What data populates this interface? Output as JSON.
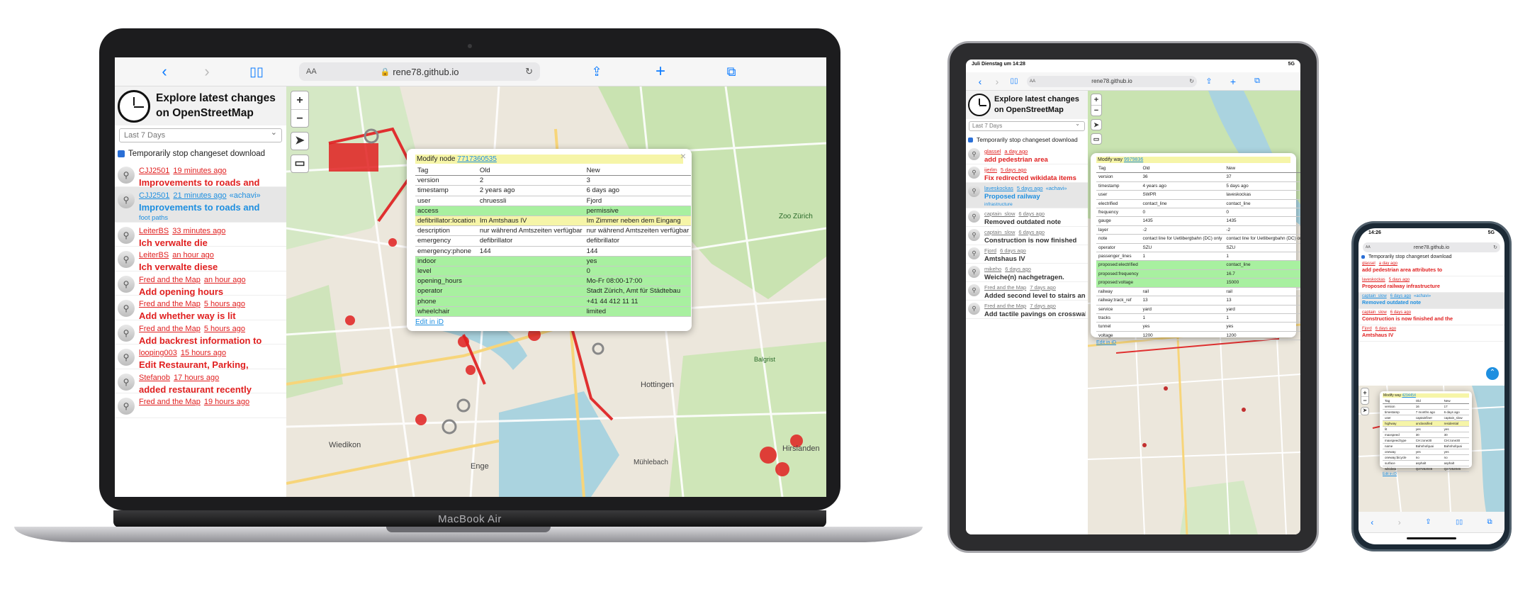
{
  "laptop": {
    "brand_label": "MacBook Air",
    "url": "rene78.github.io",
    "url_prefix": "AA",
    "app_title_line1": "Explore latest changes",
    "app_title_line2": "on OpenStreetMap",
    "period_select": "Last 7 Days",
    "stop_download_label": "Temporarily stop changeset download",
    "changesets": [
      {
        "user": "CJJ2501",
        "time": "19 minutes ago",
        "comment": "Improvements to roads and",
        "extra": "",
        "highlight": false
      },
      {
        "user": "CJJ2501",
        "time": "21 minutes ago",
        "comment": "Improvements to roads and",
        "extra": "«achavi»",
        "comment2": "foot paths",
        "highlight": true
      },
      {
        "user": "LeiterBS",
        "time": "33 minutes ago",
        "comment": "Ich verwalte die",
        "extra": "",
        "highlight": false
      },
      {
        "user": "LeiterBS",
        "time": "an hour ago",
        "comment": "Ich verwalte diese",
        "extra": "",
        "highlight": false
      },
      {
        "user": "Fred and the Map",
        "time": "an hour ago",
        "comment": "Add opening hours",
        "extra": "",
        "highlight": false
      },
      {
        "user": "Fred and the Map",
        "time": "5 hours ago",
        "comment": "Add whether way is lit",
        "extra": "",
        "highlight": false
      },
      {
        "user": "Fred and the Map",
        "time": "5 hours ago",
        "comment": "Add backrest information to",
        "extra": "",
        "highlight": false
      },
      {
        "user": "looping003",
        "time": "15 hours ago",
        "comment": "Edit Restaurant, Parking,",
        "extra": "",
        "highlight": false
      },
      {
        "user": "Stefanob",
        "time": "17 hours ago",
        "comment": "added restaurant recently",
        "extra": "",
        "highlight": false
      },
      {
        "user": "Fred and the Map",
        "time": "19 hours ago",
        "comment": "",
        "extra": "",
        "highlight": false
      }
    ],
    "popup": {
      "title_prefix": "Modify node",
      "node_id": "7717360535",
      "headers": [
        "Tag",
        "Old",
        "New"
      ],
      "rows": [
        {
          "tag": "version",
          "old": "2",
          "new": "3",
          "style": ""
        },
        {
          "tag": "timestamp",
          "old": "2 years ago",
          "new": "6 days ago",
          "style": ""
        },
        {
          "tag": "user",
          "old": "chruessli",
          "new": "Fjord",
          "style": ""
        },
        {
          "tag": "access",
          "old": "",
          "new": "permissive",
          "style": "g"
        },
        {
          "tag": "defibrillator:location",
          "old": "Im Amtshaus IV",
          "new": "Im Zimmer neben dem Eingang",
          "style": "y"
        },
        {
          "tag": "description",
          "old": "nur während Amtszeiten verfügbar",
          "new": "nur während Amtszeiten verfügbar",
          "style": ""
        },
        {
          "tag": "emergency",
          "old": "defibrillator",
          "new": "defibrillator",
          "style": ""
        },
        {
          "tag": "emergency:phone",
          "old": "144",
          "new": "144",
          "style": ""
        },
        {
          "tag": "indoor",
          "old": "",
          "new": "yes",
          "style": "g"
        },
        {
          "tag": "level",
          "old": "",
          "new": "0",
          "style": "g"
        },
        {
          "tag": "opening_hours",
          "old": "",
          "new": "Mo-Fr 08:00-17:00",
          "style": "g"
        },
        {
          "tag": "operator",
          "old": "",
          "new": "Stadt Zürich, Amt für Städtebau",
          "style": "g"
        },
        {
          "tag": "phone",
          "old": "",
          "new": "+41 44 412 11 11",
          "style": "g"
        },
        {
          "tag": "wheelchair",
          "old": "",
          "new": "limited",
          "style": "g"
        }
      ],
      "edit_link": "Edit in iD"
    },
    "map_labels": [
      "Zoo Zürich",
      "Wiedikon",
      "Hottingen",
      "Hirslanden",
      "Enge",
      "Mühlebach",
      "Balgrist"
    ]
  },
  "tablet": {
    "status_time": "Juli Dienstag um 14:28",
    "status_right": "5G",
    "url": "rene78.github.io",
    "url_prefix": "AA",
    "app_title_line1": "Explore latest changes",
    "app_title_line2": "on OpenStreetMap",
    "period_select": "Last 7 Days",
    "stop_download_label": "Temporarily stop changeset download",
    "changesets": [
      {
        "user": "glassel",
        "time": "a day ago",
        "comment": "add pedestrian area",
        "highlight": false
      },
      {
        "user": "ijerlm",
        "time": "5 days ago",
        "comment": "Fix redirected wikidata items",
        "highlight": false
      },
      {
        "user": "laveskockas",
        "time": "5 days ago",
        "extra": "«achavi»",
        "comment": "Proposed railway",
        "comment2": "infrastructure",
        "highlight": true
      },
      {
        "user": "captain_slow",
        "time": "6 days ago",
        "comment": "Removed outdated note",
        "highlight": false,
        "dark": true
      },
      {
        "user": "captain_slow",
        "time": "6 days ago",
        "comment": "Construction is now finished",
        "highlight": false,
        "dark": true
      },
      {
        "user": "Fjord",
        "time": "6 days ago",
        "comment": "Amtshaus IV",
        "highlight": false,
        "dark": true
      },
      {
        "user": "mikeho",
        "time": "6 days ago",
        "comment": "Weiche(n) nachgetragen.",
        "highlight": false,
        "dark": true
      },
      {
        "user": "Fred and the Map",
        "time": "7 days ago",
        "comment": "Added second level to stairs and",
        "highlight": false,
        "dark": true
      },
      {
        "user": "Fred and the Map",
        "time": "7 days ago",
        "comment": "Add tactile pavings on crosswalks",
        "highlight": false,
        "dark": true
      }
    ],
    "popup": {
      "title_prefix": "Modify way",
      "id": "9979836",
      "headers": [
        "Tag",
        "Old",
        "New"
      ],
      "rows": [
        {
          "tag": "version",
          "old": "36",
          "new": "37",
          "style": ""
        },
        {
          "tag": "timestamp",
          "old": "4 years ago",
          "new": "5 days ago",
          "style": ""
        },
        {
          "tag": "user",
          "old": "SWPR",
          "new": "laveskockas",
          "style": ""
        },
        {
          "tag": "electrified",
          "old": "contact_line",
          "new": "contact_line",
          "style": ""
        },
        {
          "tag": "frequency",
          "old": "0",
          "new": "0",
          "style": ""
        },
        {
          "tag": "gauge",
          "old": "1435",
          "new": "1435",
          "style": ""
        },
        {
          "tag": "layer",
          "old": "-2",
          "new": "-2",
          "style": ""
        },
        {
          "tag": "note",
          "old": "contact line for Uetlibergbahn (DC) only",
          "new": "contact line for Uetlibergbahn (DC) only",
          "style": ""
        },
        {
          "tag": "operator",
          "old": "SZU",
          "new": "SZU",
          "style": ""
        },
        {
          "tag": "passenger_lines",
          "old": "1",
          "new": "1",
          "style": ""
        },
        {
          "tag": "proposed:electrified",
          "old": "",
          "new": "contact_line",
          "style": "g"
        },
        {
          "tag": "proposed:frequency",
          "old": "",
          "new": "16.7",
          "style": "g"
        },
        {
          "tag": "proposed:voltage",
          "old": "",
          "new": "15000",
          "style": "g"
        },
        {
          "tag": "railway",
          "old": "rail",
          "new": "rail",
          "style": ""
        },
        {
          "tag": "railway:track_ref",
          "old": "13",
          "new": "13",
          "style": ""
        },
        {
          "tag": "service",
          "old": "yard",
          "new": "yard",
          "style": ""
        },
        {
          "tag": "tracks",
          "old": "1",
          "new": "1",
          "style": ""
        },
        {
          "tag": "tunnel",
          "old": "yes",
          "new": "yes",
          "style": ""
        },
        {
          "tag": "voltage",
          "old": "1200",
          "new": "1200",
          "style": ""
        }
      ],
      "edit_link": "Edit in iD"
    }
  },
  "phone": {
    "status_time": "14:26",
    "status_right": "5G",
    "url": "rene78.github.io",
    "url_prefix": "AA",
    "stop_download_label": "Temporarily stop changeset download",
    "changesets": [
      {
        "user": "glassel",
        "time": "a day ago",
        "comment": "add pedestrian area attributes to",
        "highlight": false
      },
      {
        "user": "laveskockas",
        "time": "5 days ago",
        "comment": "Proposed railway infrastructure",
        "highlight": false
      },
      {
        "user": "captain_slow",
        "time": "6 days ago",
        "extra": "«achavi»",
        "comment": "Removed outdated note",
        "highlight": true
      },
      {
        "user": "captain_slow",
        "time": "6 days ago",
        "comment": "Construction is now finished and the",
        "highlight": false
      },
      {
        "user": "Fjord",
        "time": "6 days ago",
        "comment": "Amtshaus IV",
        "highlight": false
      }
    ],
    "popup": {
      "title_prefix": "Modify way",
      "id": "4294454",
      "headers": [
        "Tag",
        "Old",
        "New"
      ],
      "rows": [
        {
          "tag": "version",
          "old": "16",
          "new": "17",
          "style": ""
        },
        {
          "tag": "timestamp",
          "old": "7 months ago",
          "new": "6 days ago",
          "style": ""
        },
        {
          "tag": "user",
          "old": "captainfiner",
          "new": "captain_slow",
          "style": ""
        },
        {
          "tag": "highway",
          "old": "unclassified",
          "new": "residential",
          "style": "y"
        },
        {
          "tag": "lit",
          "old": "yes",
          "new": "yes",
          "style": ""
        },
        {
          "tag": "maxspeed",
          "old": "30",
          "new": "30",
          "style": ""
        },
        {
          "tag": "maxspeed:type",
          "old": "CH:zone30",
          "new": "CH:zone30",
          "style": ""
        },
        {
          "tag": "name",
          "old": "Bahnhofquai",
          "new": "Bahnhofquai",
          "style": ""
        },
        {
          "tag": "oneway",
          "old": "yes",
          "new": "yes",
          "style": ""
        },
        {
          "tag": "oneway:bicycle",
          "old": "no",
          "new": "no",
          "style": ""
        },
        {
          "tag": "surface",
          "old": "asphalt",
          "new": "asphalt",
          "style": ""
        },
        {
          "tag": "wikidata",
          "old": "Q27252046",
          "new": "Q27252046",
          "style": ""
        }
      ],
      "edit_link": "Edit in iD"
    }
  }
}
